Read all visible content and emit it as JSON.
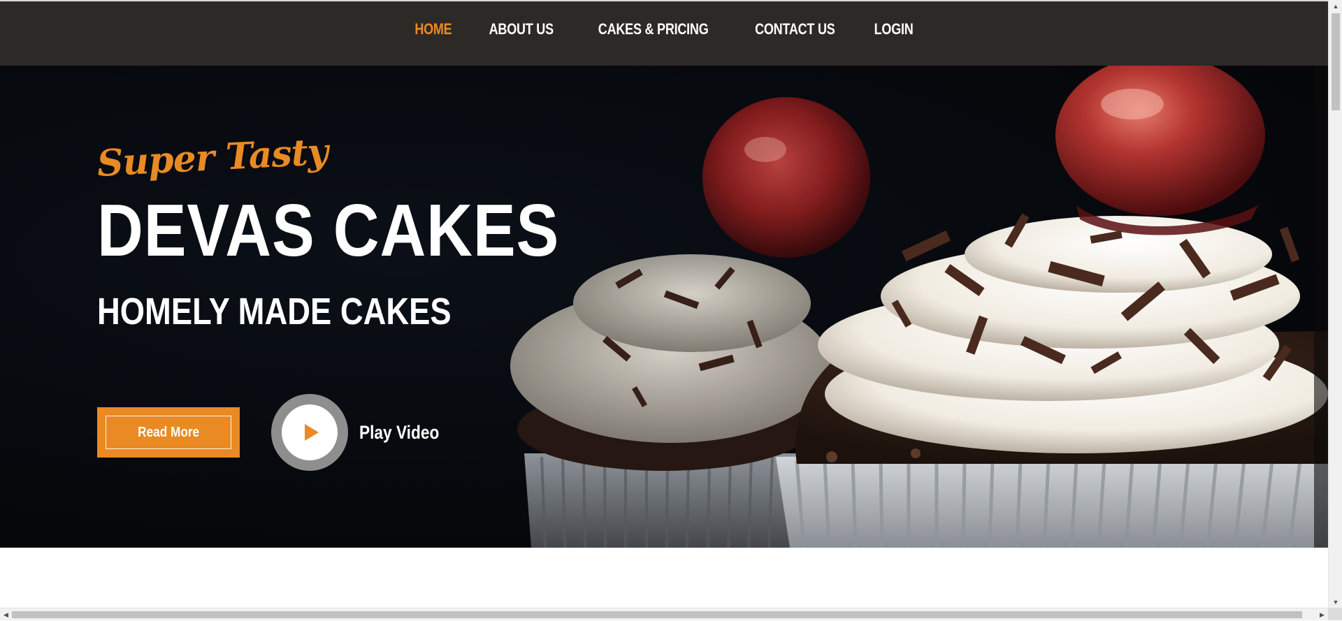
{
  "nav": {
    "items": [
      {
        "label": "HOME",
        "active": true
      },
      {
        "label": "ABOUT US",
        "active": false
      },
      {
        "label": "CAKES & PRICING",
        "active": false
      },
      {
        "label": "CONTACT US",
        "active": false
      },
      {
        "label": "LOGIN",
        "active": false
      }
    ]
  },
  "hero": {
    "tagline": "Super Tasty",
    "title": "DEVAS CAKES",
    "subtitle": "HOMELY MADE CAKES",
    "read_more_label": "Read More",
    "play_video_label": "Play Video"
  },
  "colors": {
    "accent": "#e98a24",
    "nav_background": "#2d2926",
    "hero_background": "#06080c",
    "text_light": "#ffffff"
  },
  "icons": {
    "play": "play-icon",
    "scroll_up": "arrow-up-icon",
    "scroll_down": "arrow-down-icon",
    "scroll_left": "arrow-left-icon",
    "scroll_right": "arrow-right-icon"
  }
}
